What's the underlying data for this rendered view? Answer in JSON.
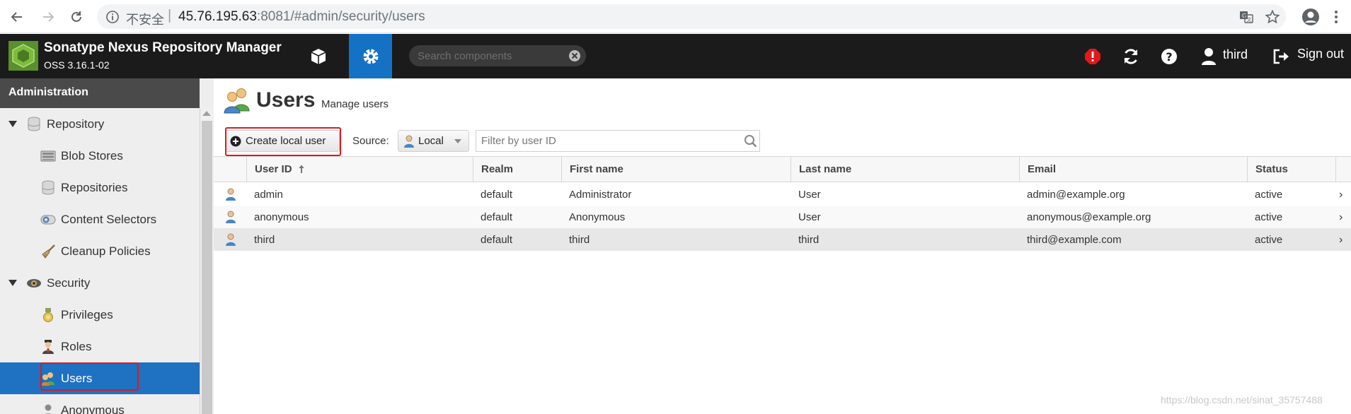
{
  "browser": {
    "insecure_label": "不安全",
    "separator": "|",
    "url_host": "45.76.195.63",
    "url_rest": ":8081/#admin/security/users"
  },
  "header": {
    "title": "Sonatype Nexus Repository Manager",
    "version": "OSS 3.16.1-02",
    "search_placeholder": "Search components",
    "user_label": "third",
    "signout_label": "Sign out"
  },
  "sidebar": {
    "title": "Administration",
    "items": [
      {
        "label": "Repository",
        "icon": "database-icon",
        "group": true
      },
      {
        "label": "Blob Stores",
        "icon": "blob-store-icon",
        "group": false
      },
      {
        "label": "Repositories",
        "icon": "database-icon",
        "group": false
      },
      {
        "label": "Content Selectors",
        "icon": "content-selector-icon",
        "group": false
      },
      {
        "label": "Cleanup Policies",
        "icon": "broom-icon",
        "group": false
      },
      {
        "label": "Security",
        "icon": "security-eye-icon",
        "group": true
      },
      {
        "label": "Privileges",
        "icon": "medal-icon",
        "group": false
      },
      {
        "label": "Roles",
        "icon": "role-user-icon",
        "group": false
      },
      {
        "label": "Users",
        "icon": "users-icon",
        "group": false,
        "selected": true
      },
      {
        "label": "Anonymous",
        "icon": "anonymous-user-icon",
        "group": false
      }
    ]
  },
  "page": {
    "title": "Users",
    "subtitle": "Manage users",
    "create_button": "Create local user",
    "source_label": "Source:",
    "source_value": "Local",
    "filter_placeholder": "Filter by user ID"
  },
  "table": {
    "columns": [
      "User ID",
      "Realm",
      "First name",
      "Last name",
      "Email",
      "Status"
    ],
    "sorted_column": "User ID",
    "rows": [
      {
        "user_id": "admin",
        "realm": "default",
        "first_name": "Administrator",
        "last_name": "User",
        "email": "admin@example.org",
        "status": "active"
      },
      {
        "user_id": "anonymous",
        "realm": "default",
        "first_name": "Anonymous",
        "last_name": "User",
        "email": "anonymous@example.org",
        "status": "active"
      },
      {
        "user_id": "third",
        "realm": "default",
        "first_name": "third",
        "last_name": "third",
        "email": "third@example.com",
        "status": "active"
      }
    ]
  },
  "watermark": "https://blog.csdn.net/sinat_35757488",
  "colors": {
    "header_bg": "#1b1b1b",
    "accent": "#1f71c2",
    "alert": "#e0191c",
    "annotation": "#e0191c"
  }
}
